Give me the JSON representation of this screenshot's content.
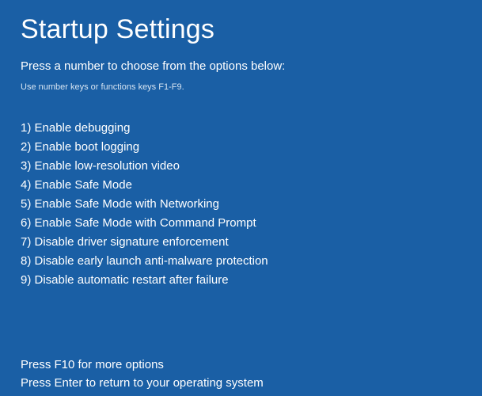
{
  "title": "Startup Settings",
  "subtitle": "Press a number to choose from the options below:",
  "hint": "Use number keys or functions keys F1-F9.",
  "options": [
    "1) Enable debugging",
    "2) Enable boot logging",
    "3) Enable low-resolution video",
    "4) Enable Safe Mode",
    "5) Enable Safe Mode with Networking",
    "6) Enable Safe Mode with Command Prompt",
    "7) Disable driver signature enforcement",
    "8) Disable early launch anti-malware protection",
    "9) Disable automatic restart after failure"
  ],
  "footer": {
    "more_options": "Press F10 for more options",
    "return_os": "Press Enter to return to your operating system"
  }
}
